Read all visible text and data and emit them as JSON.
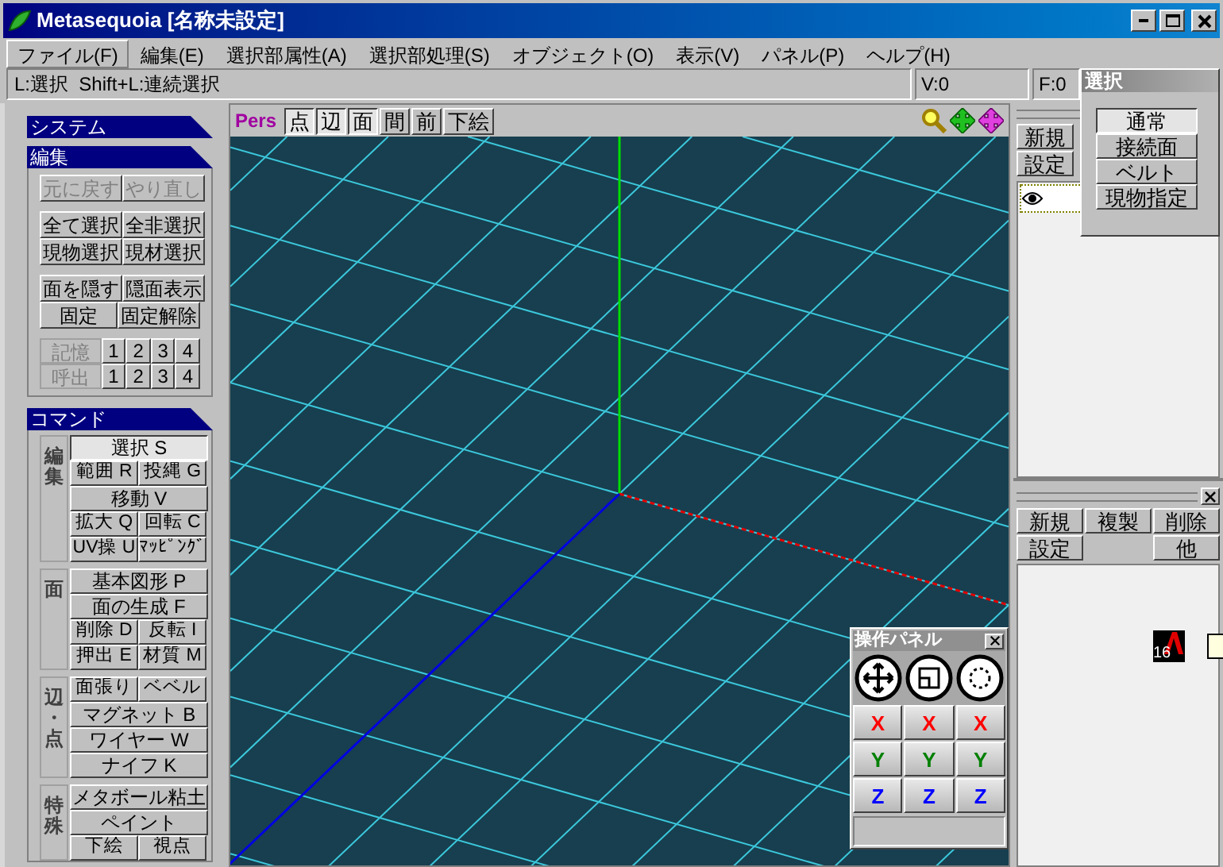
{
  "window": {
    "title": "Metasequoia [名称未設定]"
  },
  "menu": [
    {
      "label": "ファイル(F)",
      "selected": true
    },
    {
      "label": "編集(E)",
      "selected": false
    },
    {
      "label": "選択部属性(A)",
      "selected": false
    },
    {
      "label": "選択部処理(S)",
      "selected": false
    },
    {
      "label": "オブジェクト(O)",
      "selected": false
    },
    {
      "label": "表示(V)",
      "selected": false
    },
    {
      "label": "パネル(P)",
      "selected": false
    },
    {
      "label": "ヘルプ(H)",
      "selected": false
    }
  ],
  "status_bar": {
    "hint": "L:選択  Shift+L:連続選択",
    "vertices": "V:0",
    "faces": "F:0"
  },
  "left_panel": {
    "system": {
      "title": "システム"
    },
    "edit": {
      "title": "編集",
      "groups": [
        [
          [
            {
              "label": "元に戻す",
              "disabled": true
            },
            {
              "label": "やり直し",
              "disabled": true
            }
          ]
        ],
        [
          [
            {
              "label": "全て選択",
              "disabled": false
            },
            {
              "label": "全非選択",
              "disabled": false
            }
          ],
          [
            {
              "label": "現物選択",
              "disabled": false
            },
            {
              "label": "現材選択",
              "disabled": false
            }
          ]
        ],
        [
          [
            {
              "label": "面を隠す",
              "disabled": false
            },
            {
              "label": "隠面表示",
              "disabled": false
            }
          ],
          [
            {
              "label": "固定",
              "disabled": false
            },
            {
              "label": "固定解除",
              "disabled": false
            }
          ]
        ]
      ],
      "memory": [
        {
          "label": "記憶",
          "slots": [
            "1",
            "2",
            "3",
            "4"
          ]
        },
        {
          "label": "呼出",
          "slots": [
            "1",
            "2",
            "3",
            "4"
          ]
        }
      ]
    },
    "command": {
      "title": "コマンド",
      "groups": [
        {
          "label": "編集",
          "rows": [
            [
              {
                "label": "選択 S",
                "selected": true
              }
            ],
            [
              {
                "label": "範囲 R",
                "selected": false
              },
              {
                "label": "投縄 G",
                "selected": false
              }
            ],
            [
              {
                "label": "移動 V",
                "selected": false
              }
            ],
            [
              {
                "label": "拡大 Q",
                "selected": false
              },
              {
                "label": "回転 C",
                "selected": false
              }
            ],
            [
              {
                "label": "UV操 U",
                "selected": false
              },
              {
                "label": "ﾏｯﾋﾟﾝｸﾞ",
                "selected": false
              }
            ]
          ]
        },
        {
          "label": "面",
          "rows": [
            [
              {
                "label": "基本図形 P",
                "selected": false
              }
            ],
            [
              {
                "label": "面の生成 F",
                "selected": false
              }
            ],
            [
              {
                "label": "削除 D",
                "selected": false
              },
              {
                "label": "反転 I",
                "selected": false
              }
            ],
            [
              {
                "label": "押出 E",
                "selected": false
              },
              {
                "label": "材質 M",
                "selected": false
              }
            ]
          ]
        },
        {
          "label": "辺・点",
          "rows": [
            [
              {
                "label": "面張り",
                "selected": false
              },
              {
                "label": "ベベル",
                "selected": false
              }
            ],
            [
              {
                "label": "マグネット B",
                "selected": false
              }
            ],
            [
              {
                "label": "ワイヤー W",
                "selected": false
              }
            ],
            [
              {
                "label": "ナイフ K",
                "selected": false
              }
            ]
          ]
        },
        {
          "label": "特殊",
          "rows": [
            [
              {
                "label": "メタボール粘土",
                "selected": false
              }
            ],
            [
              {
                "label": "ペイント",
                "selected": false
              }
            ],
            [
              {
                "label": "下絵",
                "selected": false
              },
              {
                "label": "視点",
                "selected": false
              }
            ]
          ]
        }
      ]
    }
  },
  "viewport": {
    "projection": "Pers",
    "toggles": [
      {
        "label": "点",
        "selected": true
      },
      {
        "label": "辺",
        "selected": true
      },
      {
        "label": "面",
        "selected": true
      },
      {
        "label": "間",
        "selected": false
      },
      {
        "label": "前",
        "selected": false
      },
      {
        "label": "下絵",
        "selected": false
      }
    ]
  },
  "object_panel": {
    "buttons": [
      "新規",
      "設定"
    ]
  },
  "material_panel": {
    "rows": [
      {
        "left": [
          "新規",
          "複製",
          "削除"
        ],
        "right": []
      },
      {
        "left": [
          "設定"
        ],
        "right": [
          "他"
        ]
      }
    ]
  },
  "select_panel": {
    "title": "選択",
    "options": [
      {
        "label": "通常",
        "selected": true
      },
      {
        "label": "接続面",
        "selected": false
      },
      {
        "label": "ベルト",
        "selected": false
      },
      {
        "label": "現物指定",
        "selected": false
      }
    ]
  },
  "operation_panel": {
    "title": "操作パネル",
    "axes": [
      {
        "buttons": [
          "X",
          "X",
          "X"
        ],
        "color": "#ff0000"
      },
      {
        "buttons": [
          "Y",
          "Y",
          "Y"
        ],
        "color": "#008000"
      },
      {
        "buttons": [
          "Z",
          "Z",
          "Z"
        ],
        "color": "#0000ff"
      }
    ]
  },
  "tray": {
    "label": "16"
  }
}
